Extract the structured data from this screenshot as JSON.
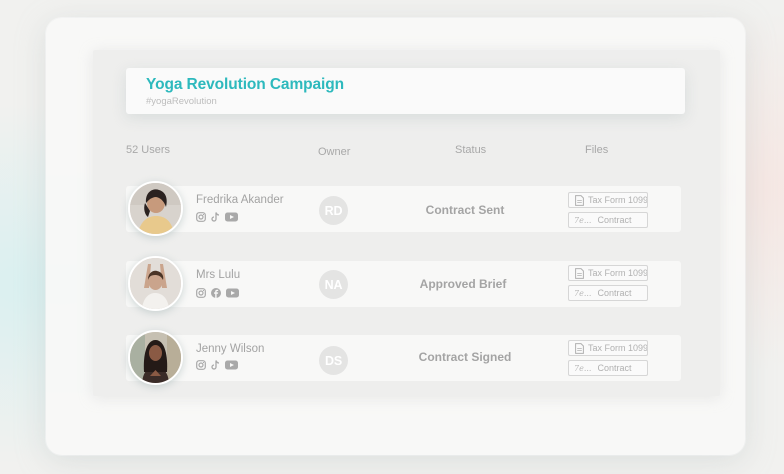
{
  "campaign": {
    "title": "Yoga Revolution Campaign",
    "hashtag": "#yogaRevolution"
  },
  "columns": {
    "users": "52 Users",
    "owner": "Owner",
    "status": "Status",
    "files": "Files"
  },
  "files_labels": {
    "tax_form": "Tax Form 1099",
    "contract": "Contract",
    "contract_prefix": "7e..."
  },
  "rows": [
    {
      "name": "Fredrika Akander",
      "socials": [
        "instagram-icon",
        "tiktok-icon",
        "youtube-icon"
      ],
      "owner_initials": "RD",
      "status": "Contract Sent"
    },
    {
      "name": "Mrs Lulu",
      "socials": [
        "instagram-icon",
        "facebook-icon",
        "youtube-icon"
      ],
      "owner_initials": "NA",
      "status": "Approved Brief"
    },
    {
      "name": "Jenny Wilson",
      "socials": [
        "instagram-icon",
        "tiktok-icon",
        "youtube-icon"
      ],
      "owner_initials": "DS",
      "status": "Contract Signed"
    }
  ],
  "colors": {
    "accent": "#2db9bd",
    "muted_text": "#a4a4a4"
  }
}
